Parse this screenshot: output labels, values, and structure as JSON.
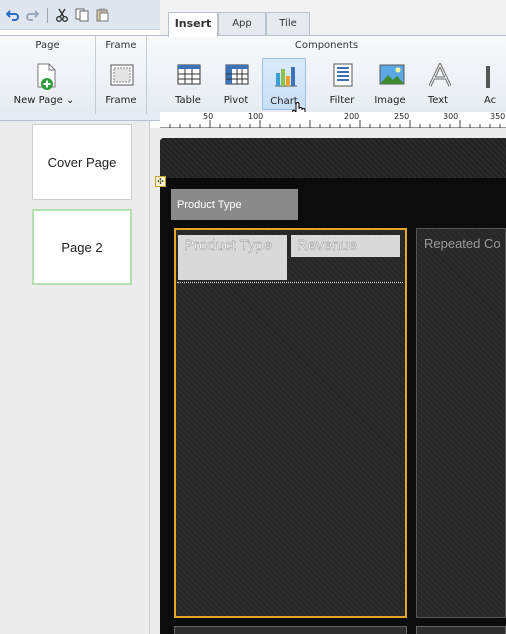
{
  "ribbon": {
    "tabs": [
      {
        "label": "Insert",
        "active": true
      },
      {
        "label": "App",
        "active": false
      },
      {
        "label": "Tile",
        "active": false
      }
    ],
    "groups": {
      "page": "Page",
      "frame": "Frame",
      "components": "Components"
    },
    "buttons": {
      "new_page": "New Page ⌄",
      "frame": "Frame",
      "table": "Table",
      "pivot": "Pivot",
      "chart": "Chart",
      "filter": "Filter",
      "image": "Image",
      "text": "Text",
      "cut_off": "Ac"
    }
  },
  "ruler": {
    "ticks": [
      "50",
      "100",
      "200",
      "250",
      "300",
      "350"
    ]
  },
  "pages": [
    {
      "label": "Cover Page",
      "selected": false
    },
    {
      "label": "Page 2",
      "selected": true
    }
  ],
  "canvas": {
    "prompt_label": "Product Type",
    "columns": [
      "Product Type",
      "Revenue"
    ],
    "repeated_label": "Repeated Co"
  },
  "colors": {
    "selection_border": "#e7a32b",
    "page_selected": "#b4e0b0",
    "ribbon_hover": "#c7def6"
  }
}
